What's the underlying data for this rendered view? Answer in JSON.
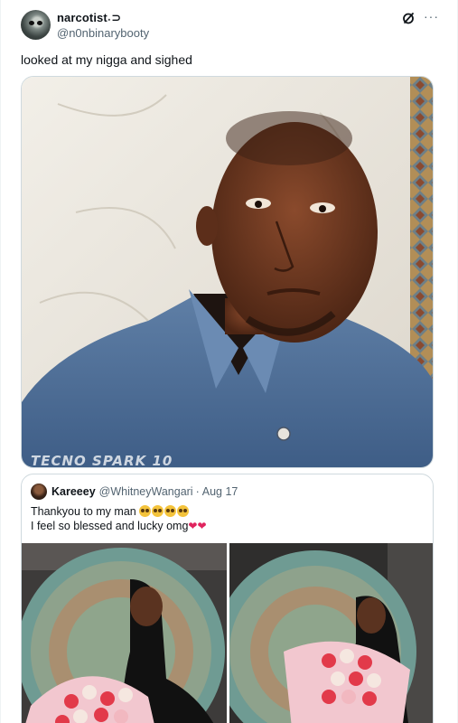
{
  "post": {
    "display_name": "narcotist˖⊃",
    "handle": "@n0nbinarybooty",
    "text": "looked at my nigga and sighed",
    "avatar_icon": "alien-avatar",
    "actions": {
      "grok_icon": "grok-icon",
      "more_icon": "more-icon",
      "more_glyph": "···"
    },
    "media": {
      "watermark": "TECNO SPARK 10"
    }
  },
  "quote": {
    "display_name": "Kareeey",
    "handle": "@WhitneyWangari",
    "separator": "·",
    "date": "Aug 17",
    "line1": "Thankyou to my man",
    "line2": "I feel so blessed and lucky omg",
    "hearts": "❤❤"
  },
  "colors": {
    "text": "#0f1419",
    "secondary": "#536471",
    "border": "#cfd9de",
    "heart": "#e0245e"
  }
}
